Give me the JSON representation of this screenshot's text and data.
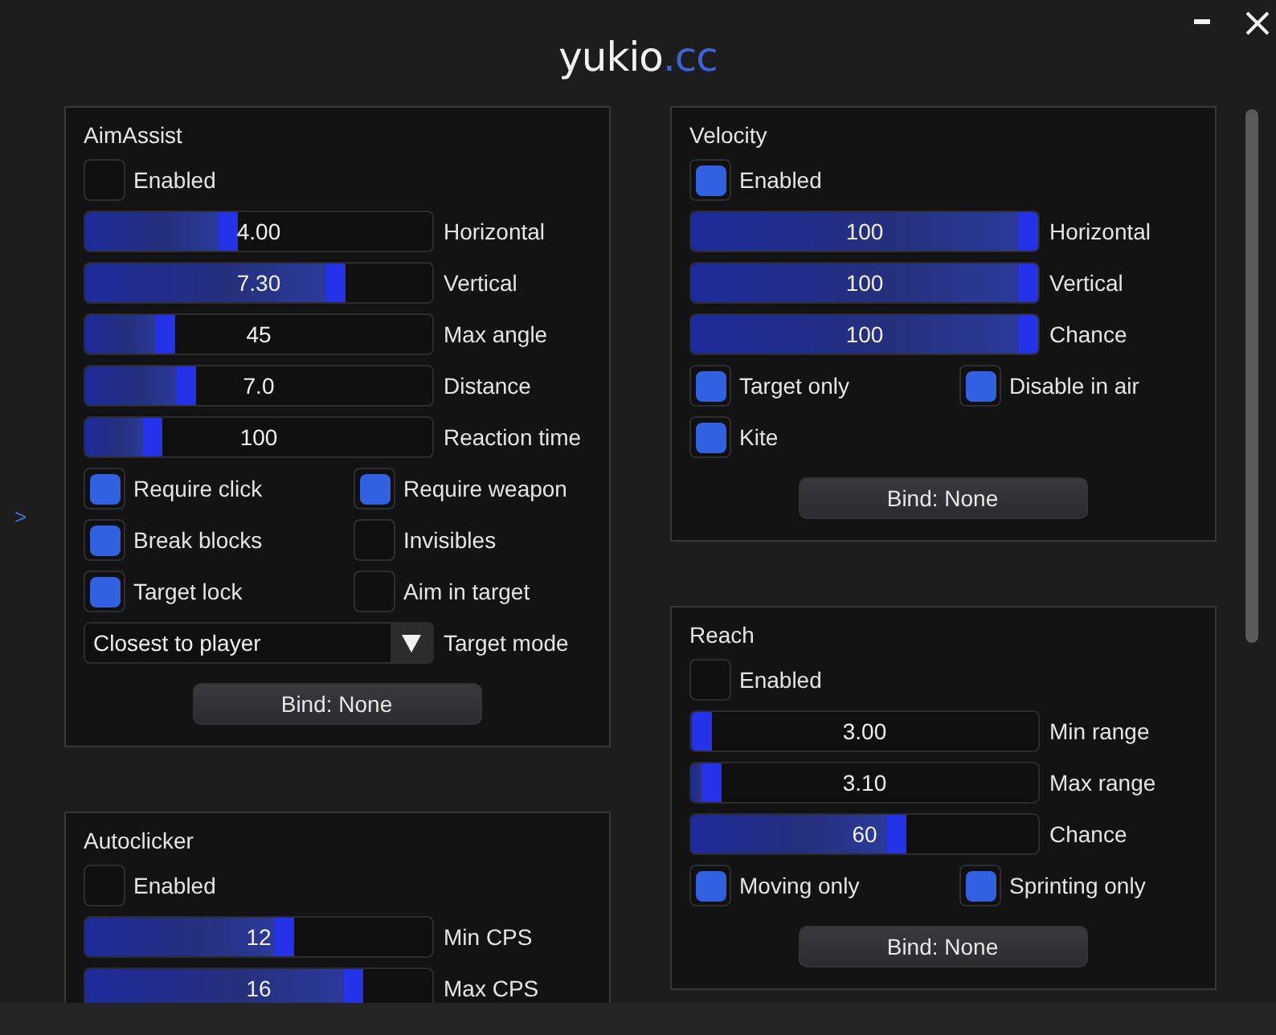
{
  "header": {
    "logo": "yukio",
    "logo_accent": ".cc"
  },
  "sidebar_toggle": ">",
  "columns": [
    {
      "panels": [
        {
          "title": "AimAssist",
          "controls": [
            {
              "kind": "checkbox",
              "label": "Enabled",
              "checked": false
            },
            {
              "kind": "slider",
              "value": "4.00",
              "label": "Horizontal",
              "level": 0.44
            },
            {
              "kind": "slider",
              "value": "7.30",
              "label": "Vertical",
              "level": 0.75
            },
            {
              "kind": "slider",
              "value": "45",
              "label": "Max angle",
              "level": 0.26
            },
            {
              "kind": "slider",
              "value": "7.0",
              "label": "Distance",
              "level": 0.32
            },
            {
              "kind": "slider",
              "value": "100",
              "label": "Reaction time",
              "level": 0.22
            },
            {
              "kind": "pair",
              "items": [
                {
                  "label": "Require click",
                  "checked": true
                },
                {
                  "label": "Require weapon",
                  "checked": true
                }
              ]
            },
            {
              "kind": "pair",
              "items": [
                {
                  "label": "Break blocks",
                  "checked": true
                },
                {
                  "label": "Invisibles",
                  "checked": false
                }
              ]
            },
            {
              "kind": "pair",
              "items": [
                {
                  "label": "Target lock",
                  "checked": true
                },
                {
                  "label": "Aim in target",
                  "checked": false
                }
              ]
            },
            {
              "kind": "dropdown",
              "value": "Closest to player",
              "label": "Target mode"
            },
            {
              "kind": "button",
              "label": "Bind: None"
            }
          ]
        },
        {
          "title": "Autoclicker",
          "controls": [
            {
              "kind": "checkbox",
              "label": "Enabled",
              "checked": false
            },
            {
              "kind": "slider",
              "value": "12",
              "label": "Min CPS",
              "level": 0.6
            },
            {
              "kind": "slider",
              "value": "16",
              "label": "Max CPS",
              "level": 0.8
            }
          ]
        }
      ]
    },
    {
      "panels": [
        {
          "title": "Velocity",
          "controls": [
            {
              "kind": "checkbox",
              "label": "Enabled",
              "checked": true
            },
            {
              "kind": "slider",
              "value": "100",
              "label": "Horizontal",
              "level": 1
            },
            {
              "kind": "slider",
              "value": "100",
              "label": "Vertical",
              "level": 1
            },
            {
              "kind": "slider",
              "value": "100",
              "label": "Chance",
              "level": 1
            },
            {
              "kind": "pair",
              "items": [
                {
                  "label": "Target only",
                  "checked": true
                },
                {
                  "label": "Disable in air",
                  "checked": true
                }
              ]
            },
            {
              "kind": "checkbox",
              "label": "Kite",
              "checked": true
            },
            {
              "kind": "button",
              "label": "Bind: None"
            }
          ]
        },
        {
          "title": "Reach",
          "controls": [
            {
              "kind": "checkbox",
              "label": "Enabled",
              "checked": false
            },
            {
              "kind": "slider",
              "value": "3.00",
              "label": "Min range",
              "level": 0.06
            },
            {
              "kind": "slider",
              "value": "3.10",
              "label": "Max range",
              "level": 0.09
            },
            {
              "kind": "slider",
              "value": "60",
              "label": "Chance",
              "level": 0.62
            },
            {
              "kind": "pair",
              "items": [
                {
                  "label": "Moving only",
                  "checked": true
                },
                {
                  "label": "Sprinting only",
                  "checked": true
                }
              ]
            },
            {
              "kind": "button",
              "label": "Bind: None"
            }
          ]
        }
      ]
    }
  ]
}
